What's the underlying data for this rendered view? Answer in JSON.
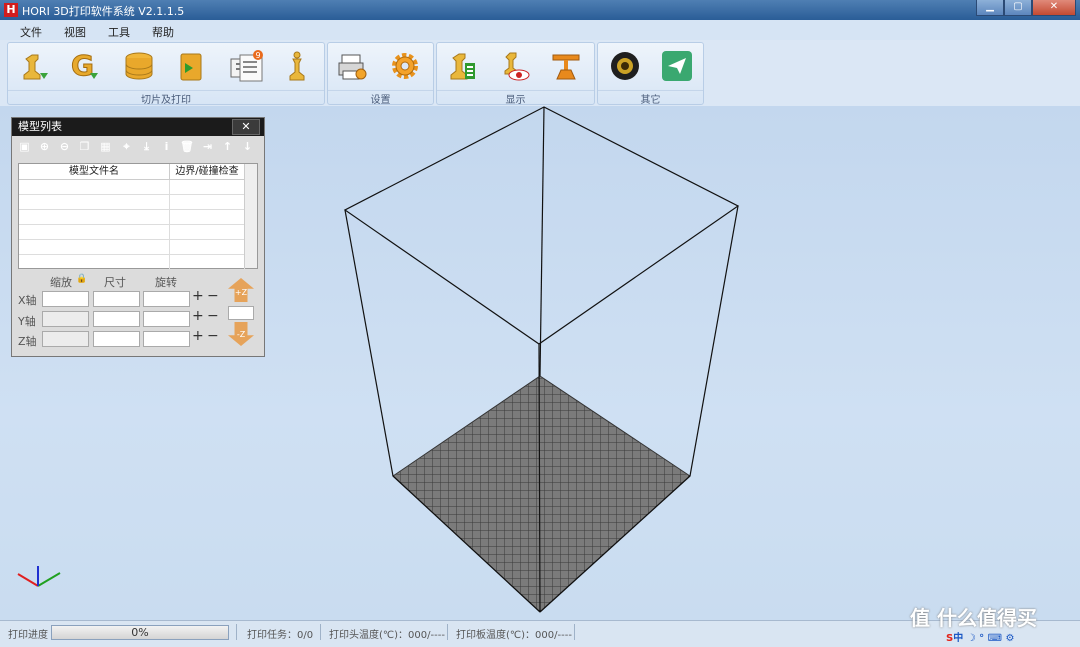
{
  "window": {
    "title": "HORI 3D打印软件系统 V2.1.1.5",
    "logo_letter": "H"
  },
  "menu": [
    "文件",
    "视图",
    "工具",
    "帮助"
  ],
  "toolbar": {
    "groups": [
      {
        "label": "切片及打印",
        "icons": [
          "slice-figure-icon",
          "gcode-icon",
          "database-icon",
          "export-sd-icon",
          "print-queue-icon",
          "chess-piece-icon"
        ]
      },
      {
        "label": "设置",
        "icons": [
          "printer-settings-icon",
          "gear-icon"
        ]
      },
      {
        "label": "显示",
        "icons": [
          "show-model-icon",
          "preview-eye-icon",
          "platform-icon"
        ]
      },
      {
        "label": "其它",
        "icons": [
          "webcam-icon",
          "send-icon"
        ]
      }
    ],
    "print_queue_badge": "9"
  },
  "model_panel": {
    "title": "模型列表",
    "close": "✕",
    "columns": [
      "模型文件名",
      "边界/碰撞检查"
    ],
    "rows": [
      [
        "",
        ""
      ],
      [
        "",
        ""
      ],
      [
        "",
        ""
      ],
      [
        "",
        ""
      ],
      [
        "",
        ""
      ],
      [
        "",
        ""
      ]
    ],
    "transform_headers": [
      "缩放",
      "尺寸",
      "旋转"
    ],
    "axes": [
      "X轴",
      "Y轴",
      "Z轴"
    ],
    "plus": "+",
    "minus": "−",
    "z_up": "+Z",
    "z_down": "-Z"
  },
  "status": {
    "progress_label": "打印进度",
    "progress_value": "0%",
    "task": "打印任务：0/0",
    "head_temp": "打印头温度(℃)：000/----",
    "bed_temp": "打印板温度(℃)：000/----"
  },
  "watermark": "值 什么值得买",
  "tray_text": "S中"
}
